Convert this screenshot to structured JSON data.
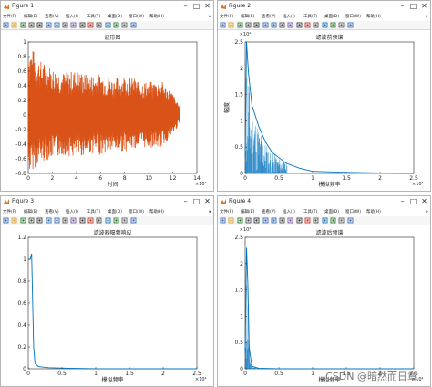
{
  "colors": {
    "waveform": "#d95319",
    "spectrum": "#0072bd",
    "axis": "#262626",
    "window_bg": "#f0f0f0"
  },
  "menu": [
    "文件(F)",
    "编辑(E)",
    "查看(V)",
    "插入(I)",
    "工具(T)",
    "桌面(D)",
    "窗口(W)",
    "帮助(H)"
  ],
  "menu_overflow_icon": "triangle-right-icon",
  "toolbar_icons": [
    "new-figure-icon",
    "open-icon",
    "save-icon",
    "print-icon",
    "pointer-icon",
    "zoom-in-icon",
    "zoom-out-icon",
    "pan-icon",
    "rotate-icon",
    "data-cursor-icon",
    "brush-icon",
    "link-icon",
    "colorbar-icon",
    "legend-icon",
    "hide-plot-tools-icon",
    "show-plot-tools-icon"
  ],
  "window_controls": {
    "minimize": "–",
    "maximize": "□",
    "close": "✕"
  },
  "windows": [
    {
      "title": "Figure 1",
      "axes_title": "波形图",
      "xlabel": "时间",
      "ylabel": "",
      "x_exponent": "×10⁴",
      "y_exponent": "",
      "yticks": [
        "1",
        "0.8",
        "0.6",
        "0.4",
        "0.2",
        "0",
        "-0.2",
        "-0.4",
        "-0.6",
        "-0.8"
      ],
      "xticks": [
        "0",
        "2",
        "4",
        "6",
        "8",
        "10",
        "12",
        "14"
      ]
    },
    {
      "title": "Figure 2",
      "axes_title": "滤波前频谱",
      "xlabel": "模拟频率",
      "ylabel": "幅度",
      "x_exponent": "×10⁴",
      "y_exponent": "×10⁴",
      "yticks": [
        "2.5",
        "2",
        "1.5",
        "1",
        "0.5",
        "0"
      ],
      "xticks": [
        "0",
        "0.5",
        "1",
        "1.5",
        "2",
        "2.5"
      ]
    },
    {
      "title": "Figure 3",
      "axes_title": "滤波器幅频响应",
      "xlabel": "模拟频率",
      "ylabel": "",
      "x_exponent": "×10⁴",
      "y_exponent": "",
      "yticks": [
        "1.2",
        "1",
        "0.8",
        "0.6",
        "0.4",
        "0.2",
        "0"
      ],
      "xticks": [
        "0",
        "0.5",
        "1",
        "1.5",
        "2",
        "2.5"
      ]
    },
    {
      "title": "Figure 4",
      "axes_title": "滤波后频谱",
      "xlabel": "模拟频率",
      "ylabel": "",
      "x_exponent": "×10⁴",
      "y_exponent": "×10⁴",
      "yticks": [
        "2.5",
        "2",
        "1.5",
        "1",
        "0.5",
        "0"
      ],
      "xticks": [
        "0",
        "0.5",
        "1",
        "1.5",
        "2",
        "2.5"
      ]
    }
  ],
  "chart_data": [
    {
      "type": "line",
      "title": "波形图",
      "xlabel": "时间",
      "ylabel": "",
      "xlim": [
        0,
        14
      ],
      "ylim": [
        -0.8,
        1
      ],
      "x_scale": "×10⁴",
      "grid": false,
      "series": [
        {
          "values_note": "",
          "x": [
            0,
            0.4,
            1,
            2,
            3,
            4,
            5,
            6,
            7,
            8,
            9,
            10,
            11,
            12,
            12.6
          ],
          "y_upper": [
            0.97,
            0.9,
            0.75,
            0.65,
            0.58,
            0.62,
            0.55,
            0.57,
            0.5,
            0.55,
            0.5,
            0.45,
            0.48,
            0.3,
            0.1
          ],
          "y_lower": [
            -0.8,
            -0.75,
            -0.65,
            -0.6,
            -0.55,
            -0.6,
            -0.52,
            -0.55,
            -0.5,
            -0.5,
            -0.45,
            -0.45,
            -0.45,
            -0.28,
            -0.1
          ]
        }
      ]
    },
    {
      "type": "line",
      "title": "滤波前频谱",
      "xlabel": "模拟频率",
      "ylabel": "幅度",
      "xlim": [
        0,
        2.5
      ],
      "ylim": [
        0,
        2.5
      ],
      "x_scale": "×10⁴",
      "y_scale": "×10⁴",
      "grid": false,
      "series": [
        {
          "x": [
            0,
            0.02,
            0.05,
            0.1,
            0.2,
            0.3,
            0.4,
            0.5,
            0.6,
            0.8,
            1,
            1.5,
            2,
            2.5
          ],
          "y": [
            0.3,
            2.5,
            1.9,
            1.3,
            0.9,
            0.6,
            0.4,
            0.3,
            0.2,
            0.1,
            0.04,
            0.02,
            0.01,
            0.0
          ]
        }
      ]
    },
    {
      "type": "line",
      "title": "滤波器幅频响应",
      "xlabel": "模拟频率",
      "ylabel": "",
      "xlim": [
        0,
        2.5
      ],
      "ylim": [
        0,
        1.2
      ],
      "x_scale": "×10⁴",
      "grid": false,
      "series": [
        {
          "x": [
            0,
            0.03,
            0.05,
            0.08,
            0.1,
            0.15,
            0.3,
            0.6,
            1,
            1.5,
            2,
            2.5
          ],
          "y": [
            1.0,
            1.0,
            1.05,
            0.2,
            0.05,
            0.02,
            0.01,
            0.005,
            0.0,
            0.0,
            0.0,
            0.0
          ]
        }
      ]
    },
    {
      "type": "line",
      "title": "滤波后频谱",
      "xlabel": "模拟频率",
      "ylabel": "",
      "xlim": [
        0,
        2.5
      ],
      "ylim": [
        0,
        2.5
      ],
      "x_scale": "×10⁴",
      "y_scale": "×10⁴",
      "grid": false,
      "series": [
        {
          "x": [
            0,
            0.02,
            0.04,
            0.06,
            0.1,
            0.2,
            0.5,
            1,
            2,
            2.5
          ],
          "y": [
            0.3,
            2.3,
            1.6,
            0.4,
            0.05,
            0.01,
            0.0,
            0.0,
            0.0,
            0.0
          ]
        }
      ]
    }
  ],
  "watermark": "CSDN @暗然而日章"
}
